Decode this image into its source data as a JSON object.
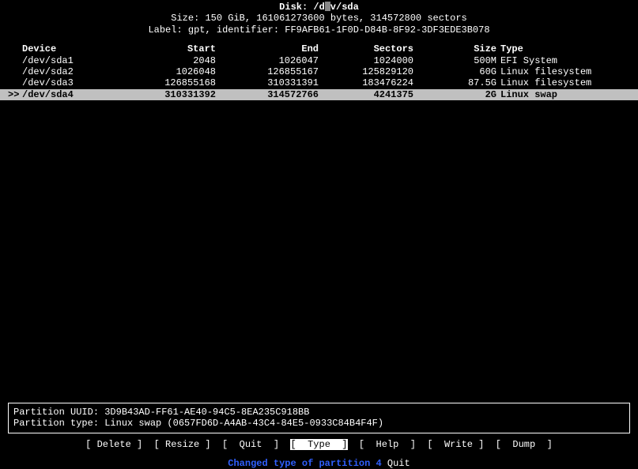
{
  "header": {
    "disk_label": "Disk: ",
    "disk_path_pre": "/d",
    "disk_path_post": "v/sda",
    "size_line": "Size: 150 GiB, 161061273600 bytes, 314572800 sectors",
    "label_line": "Label: gpt, identifier: FF9AFB61-1F0D-D84B-8F92-3DF3EDE3B078"
  },
  "columns": {
    "device": "Device",
    "start": "Start",
    "end": "End",
    "sectors": "Sectors",
    "size": "Size",
    "type": "Type"
  },
  "partitions": [
    {
      "marker": "",
      "device": "/dev/sda1",
      "start": "2048",
      "end": "1026047",
      "sectors": "1024000",
      "size": "500M",
      "type": "EFI System"
    },
    {
      "marker": "",
      "device": "/dev/sda2",
      "start": "1026048",
      "end": "126855167",
      "sectors": "125829120",
      "size": "60G",
      "type": "Linux filesystem"
    },
    {
      "marker": "",
      "device": "/dev/sda3",
      "start": "126855168",
      "end": "310331391",
      "sectors": "183476224",
      "size": "87.5G",
      "type": "Linux filesystem"
    },
    {
      "marker": ">>",
      "device": "/dev/sda4",
      "start": "310331392",
      "end": "314572766",
      "sectors": "4241375",
      "size": "2G",
      "type": "Linux swap"
    }
  ],
  "info": {
    "uuid_label": "Partition UUID: ",
    "uuid_value": "3D9B43AD-FF61-AE40-94C5-8EA235C918BB",
    "type_label": "Partition type: ",
    "type_value": "Linux swap (0657FD6D-A4AB-43C4-84E5-0933C84B4F4F)"
  },
  "menu": {
    "delete": "Delete",
    "resize": "Resize",
    "quit": "Quit",
    "type": "Type",
    "help": "Help",
    "write": "Write",
    "dump": "Dump"
  },
  "status": {
    "message": "Changed type of partition 4",
    "tail": " Quit"
  }
}
